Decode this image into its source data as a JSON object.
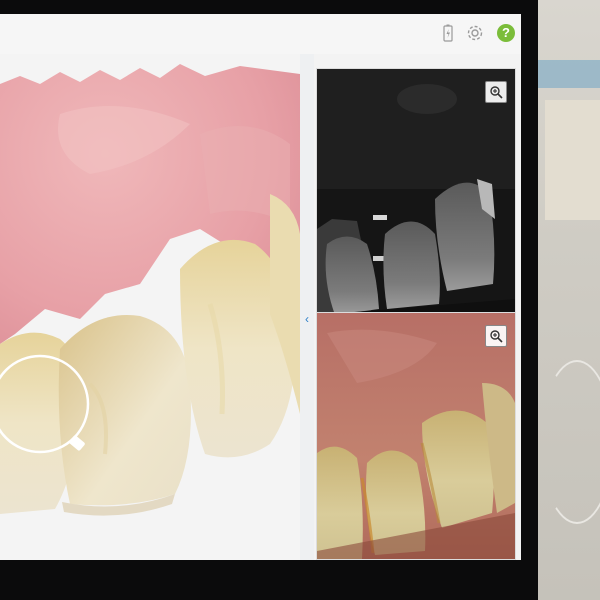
{
  "toolbar": {
    "icons": [
      "battery-icon",
      "gear-icon",
      "help-icon"
    ],
    "help_label": "?"
  },
  "scan_view": {
    "tools": [
      "magnifier-lens"
    ]
  },
  "side_panels": {
    "collapse_arrow": "‹",
    "panels": [
      {
        "name": "infrared-view",
        "zoom_icon": "zoom-in-icon"
      },
      {
        "name": "color-view",
        "zoom_icon": "zoom-in-icon"
      }
    ]
  },
  "colors": {
    "accent": "#2d7fc8",
    "help_green": "#7bbd3a",
    "gum_pink": "#e7a3a8",
    "tooth": "#ede1bd"
  }
}
